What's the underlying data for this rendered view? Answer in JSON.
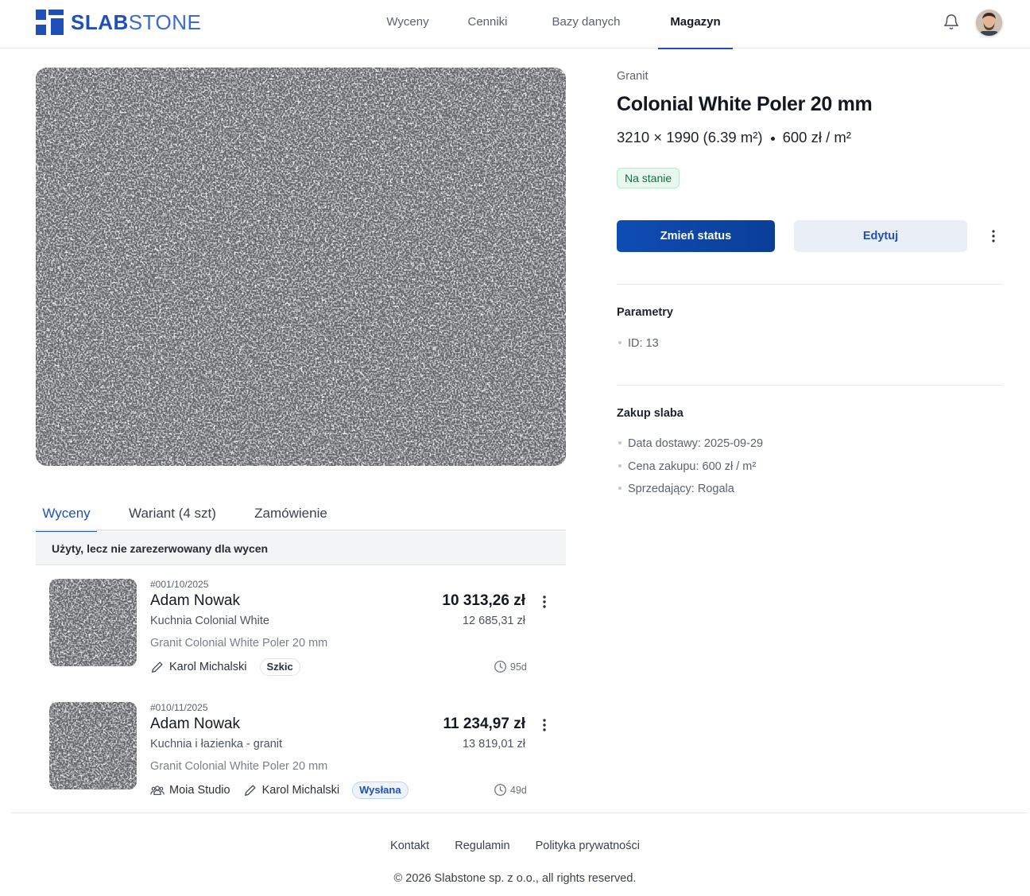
{
  "brand": {
    "name_bold": "SLAB",
    "name_light": "STONE",
    "color": "#1f4fb8"
  },
  "nav": {
    "items": [
      {
        "label": "Wyceny"
      },
      {
        "label": "Cenniki"
      },
      {
        "label": "Bazy danych"
      },
      {
        "label": "Magazyn",
        "active": true
      }
    ]
  },
  "header_icons": [
    "bell-icon",
    "avatar"
  ],
  "product": {
    "category": "Granit",
    "title": "Colonial White Poler 20 mm",
    "dimensions": "3210 × 1990 (6.39 m²)",
    "price": "600 zł / m²",
    "status_badge": "Na stanie",
    "status_color": "#176b41"
  },
  "actions": {
    "primary_label": "Zmień status",
    "secondary_label": "Edytuj"
  },
  "parameters": {
    "title": "Parametry",
    "items": [
      "ID: 13"
    ]
  },
  "purchase": {
    "title": "Zakup slaba",
    "items": [
      "Data dostawy: 2025-09-29",
      "Cena zakupu: 600 zł / m²",
      "Sprzedający: Rogala"
    ]
  },
  "tabs": [
    {
      "label": "Wyceny",
      "active": true
    },
    {
      "label": "Wariant (4 szt)"
    },
    {
      "label": "Zamówienie"
    }
  ],
  "notice": "Użyty, lecz nie zarezerwowany dla wycen",
  "quotes": [
    {
      "number": "#001/10/2025",
      "client": "Adam Nowak",
      "project": "Kuchnia Colonial White",
      "material": "Granit Colonial White Poler 20 mm",
      "price": "10 313,26 zł",
      "price_gross": "12 685,31 zł",
      "author": "Karol Michalski",
      "status": "Szkic",
      "age": "95d"
    },
    {
      "number": "#010/11/2025",
      "client": "Adam Nowak",
      "project": "Kuchnia i łazienka - granit",
      "material": "Granit Colonial White Poler 20 mm",
      "price": "11 234,97 zł",
      "price_gross": "13 819,01 zł",
      "studio": "Moia Studio",
      "author": "Karol Michalski",
      "status": "Wysłana",
      "age": "49d"
    }
  ],
  "footer": {
    "links": [
      "Kontakt",
      "Regulamin",
      "Polityka prywatności"
    ],
    "copyright": "© 2026 Slabstone sp. z o.o., all rights reserved."
  }
}
